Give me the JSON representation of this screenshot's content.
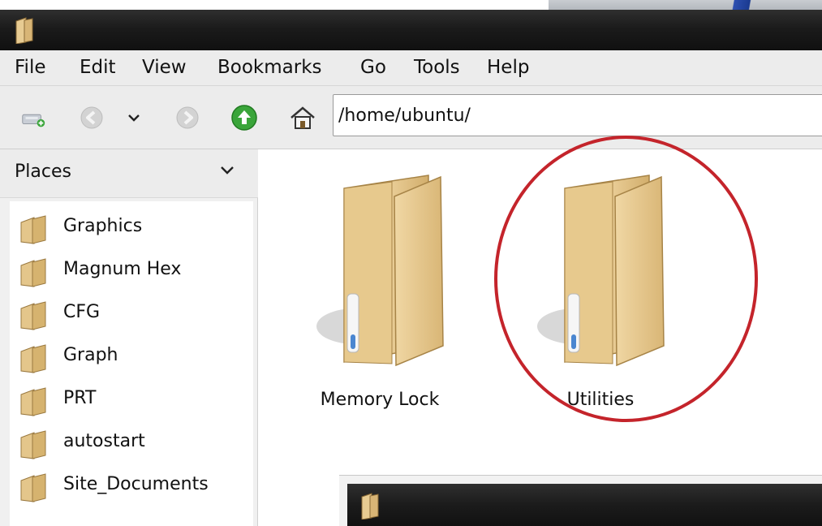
{
  "menu": {
    "file": "File",
    "edit": "Edit",
    "view": "View",
    "bookmarks": "Bookmarks",
    "go": "Go",
    "tools": "Tools",
    "help": "Help"
  },
  "toolbar": {
    "icons": [
      "new-tab-icon",
      "back-icon",
      "history-dropdown-icon",
      "forward-icon",
      "up-folder-icon",
      "home-icon"
    ],
    "address": "/home/ubuntu/"
  },
  "sidebar": {
    "title": "Places",
    "items": [
      {
        "label": "Graphics"
      },
      {
        "label": "Magnum Hex"
      },
      {
        "label": "CFG"
      },
      {
        "label": "Graph"
      },
      {
        "label": "PRT"
      },
      {
        "label": "autostart"
      },
      {
        "label": "Site_Documents"
      }
    ]
  },
  "files": [
    {
      "name": "Memory Lock",
      "type": "folder"
    },
    {
      "name": "Utilities",
      "type": "folder",
      "highlighted": true
    }
  ],
  "colors": {
    "titlebar": "#1b1b1b",
    "folder": "#e3c48a",
    "annotation": "#c4242b",
    "up_arrow": "#3aa53a"
  }
}
